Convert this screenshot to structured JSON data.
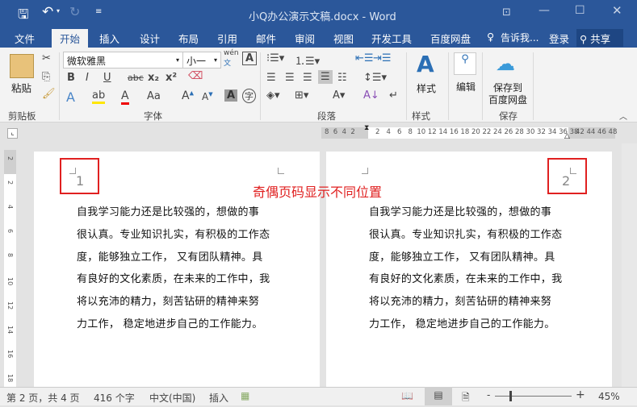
{
  "titlebar": {
    "title": "小Q办公演示文稿.docx - Word",
    "save_icon": "save-icon",
    "undo_icon": "undo-icon",
    "redo_icon": "redo-icon"
  },
  "tabs": [
    "文件",
    "开始",
    "插入",
    "设计",
    "布局",
    "引用",
    "邮件",
    "审阅",
    "视图",
    "开发工具",
    "百度网盘"
  ],
  "tell_me": "告诉我...",
  "login": "登录",
  "share": "共享",
  "ribbon": {
    "paste": "粘贴",
    "clipboard": "剪贴板",
    "font_name": "微软雅黑",
    "font_size": "小一",
    "font_group": "字体",
    "paragraph_group": "段落",
    "styles": "样式",
    "styles_group": "样式",
    "edit": "编辑",
    "save_baidu": "保存到",
    "save_baidu2": "百度网盘",
    "save_group": "保存",
    "wen": "wén",
    "wen2": "文",
    "bold": "B",
    "italic": "I",
    "underline": "U",
    "strike": "abc",
    "sub": "x₂",
    "sup": "x²",
    "aa": "Aa"
  },
  "ruler": {
    "left_ticks": "8  6  4  2",
    "ticks": "2   4   6   8  10 12 14 16 18 20 22 24 26 28 30 32 34 36 38",
    "right_ticks": "42 44 46 48"
  },
  "document": {
    "annotation": "奇偶页码显示不同位置",
    "annotation_color": "#e02020",
    "page1_number": "1",
    "page2_number": "2",
    "lines": [
      "自我学习能力还是比较强的，想做的事",
      "很认真。专业知识扎实，有积极的工作态",
      "度，能够独立工作，  又有团队精神。具",
      "有良好的文化素质，在未来的工作中，我",
      "将以充沛的精力，刻苦钻研的精神来努",
      "力工作，  稳定地进步自己的工作能力。"
    ]
  },
  "vruler": [
    "2",
    "2",
    "4",
    "6",
    "8",
    "10",
    "12",
    "14",
    "16",
    "18"
  ],
  "status": {
    "page": "第 2 页，共 4 页",
    "words": "416 个字",
    "lang": "中文(中国)",
    "mode": "插入",
    "zoom": "45%",
    "zoom_level": 45
  },
  "colors": {
    "brand": "#2b579a"
  }
}
